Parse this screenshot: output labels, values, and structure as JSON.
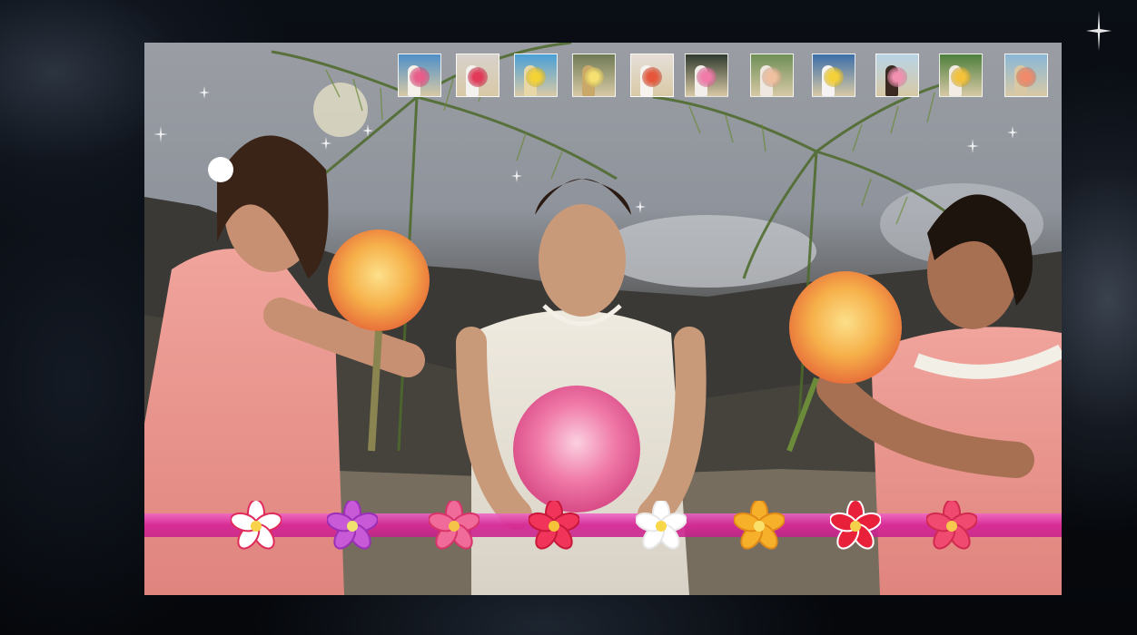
{
  "colors": {
    "flower_bar": "#d42896",
    "dress": "#e9958e",
    "bouquet_pink": "#f07aa8",
    "bouquet_yellow": "#f6b04a"
  },
  "thumbnails": [
    {
      "icon": "beach-couple-photo-icon",
      "bg": "#4f8fc8",
      "bouquet": "#e85d8a",
      "figure": "#f5f0ea"
    },
    {
      "icon": "couple-photo-icon",
      "bg": "#d8d2cc",
      "bouquet": "#e23a58",
      "figure": "#f4f2ee"
    },
    {
      "icon": "beach-bouquet-photo-icon",
      "bg": "#4aa0d6",
      "bouquet": "#f3d236",
      "figure": "#e8d8a8"
    },
    {
      "icon": "yellow-bouquet-photo-icon",
      "bg": "#6f7a55",
      "bouquet": "#f5e070",
      "figure": "#c9a86a"
    },
    {
      "icon": "bride-umbrella-photo-icon",
      "bg": "#e6dfd8",
      "bouquet": "#e6563a",
      "figure": "#f7f4f0"
    },
    {
      "icon": "bride-pink-bouquet-photo-icon",
      "bg": "#2f3a2e",
      "bouquet": "#f07aa8",
      "figure": "#f2eeea"
    },
    {
      "icon": "wedding-party-photo-icon",
      "bg": "#6e8f56",
      "bouquet": "#f0c0a0",
      "figure": "#efe8e0"
    },
    {
      "icon": "bride-yellow-bouquet-photo-icon",
      "bg": "#3b6ea8",
      "bouquet": "#f4d13a",
      "figure": "#f6f4f2"
    },
    {
      "icon": "bride-portrait-photo-icon",
      "bg": "#b8d4e6",
      "bouquet": "#f290b0",
      "figure": "#3a2a22"
    },
    {
      "icon": "couple-kiss-photo-icon",
      "bg": "#4e7f3c",
      "bouquet": "#f3c23a",
      "figure": "#f2ece4"
    },
    {
      "icon": "beach-flowers-photo-icon",
      "bg": "#8ab7d6",
      "bouquet": "#f08a6a",
      "figure": "#d8c8a4"
    }
  ],
  "flowers": [
    {
      "icon": "white-pink-plumeria-icon",
      "petal": "#ffffff",
      "edge": "#e02a5a",
      "center": "#f7d24a"
    },
    {
      "icon": "purple-plumeria-icon",
      "petal": "#c85ad8",
      "edge": "#9a2fb8",
      "center": "#f0e070"
    },
    {
      "icon": "pink-plumeria-icon",
      "petal": "#f06a9a",
      "edge": "#d8346a",
      "center": "#f5c24a"
    },
    {
      "icon": "red-plumeria-icon",
      "petal": "#f0345a",
      "edge": "#c8183a",
      "center": "#f6c23a"
    },
    {
      "icon": "white-plumeria-icon",
      "petal": "#ffffff",
      "edge": "#e8e8e8",
      "center": "#f6d84a"
    },
    {
      "icon": "yellow-plumeria-icon",
      "petal": "#f6b02a",
      "edge": "#e08a18",
      "center": "#f8e06a"
    },
    {
      "icon": "red-white-plumeria-icon",
      "petal": "#e8203a",
      "edge": "#ffffff",
      "center": "#f5d04a"
    },
    {
      "icon": "rose-plumeria-icon",
      "petal": "#f04a70",
      "edge": "#d02a50",
      "center": "#f6c850"
    }
  ]
}
